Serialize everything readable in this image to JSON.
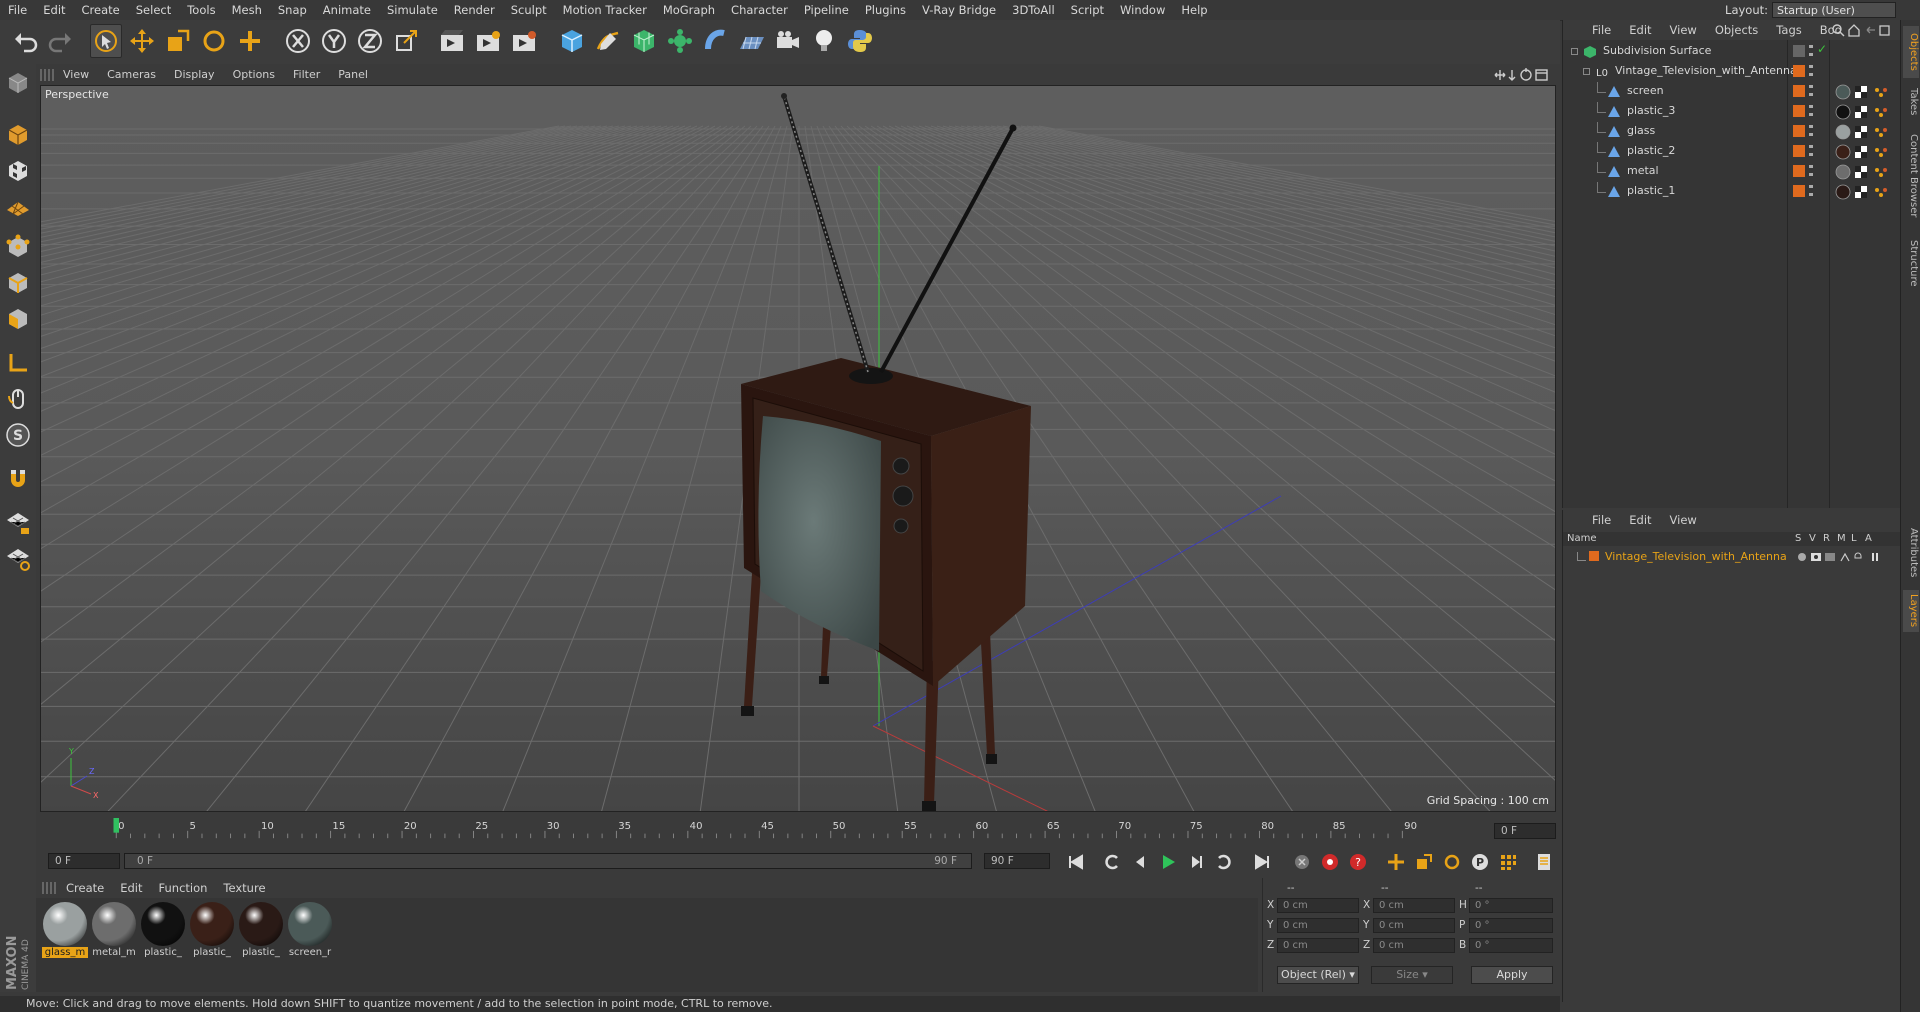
{
  "menubar": {
    "items": [
      "File",
      "Edit",
      "Create",
      "Select",
      "Tools",
      "Mesh",
      "Snap",
      "Animate",
      "Simulate",
      "Render",
      "Sculpt",
      "Motion Tracker",
      "MoGraph",
      "Character",
      "Pipeline",
      "Plugins",
      "V-Ray Bridge",
      "3DToAll",
      "Script",
      "Window",
      "Help"
    ],
    "layout_label": "Layout:",
    "layout_value": "Startup (User)"
  },
  "viewport": {
    "menu": [
      "View",
      "Cameras",
      "Display",
      "Options",
      "Filter",
      "Panel"
    ],
    "camera_label": "Perspective",
    "grid_spacing": "Grid Spacing : 100 cm"
  },
  "timeline": {
    "ticks": [
      "0",
      "5",
      "10",
      "15",
      "20",
      "25",
      "30",
      "35",
      "40",
      "45",
      "50",
      "55",
      "60",
      "65",
      "70",
      "75",
      "80",
      "85",
      "90"
    ],
    "current_frame": "0 F",
    "start_field": "0 F",
    "range_start": "0 F",
    "range_end": "90 F",
    "end_field": "90 F",
    "right_field": "0 F"
  },
  "materials": {
    "menu": [
      "Create",
      "Edit",
      "Function",
      "Texture"
    ],
    "items": [
      {
        "label": "glass_m",
        "color": "#9aa0a0"
      },
      {
        "label": "metal_m",
        "color": "#6d6d6d"
      },
      {
        "label": "plastic_",
        "color": "#111111"
      },
      {
        "label": "plastic_",
        "color": "#3a2018"
      },
      {
        "label": "plastic_",
        "color": "#2a1a16"
      },
      {
        "label": "screen_r",
        "color": "#4b5a58"
      }
    ]
  },
  "coords": {
    "headers": [
      "--",
      "--",
      "--"
    ],
    "rows": [
      {
        "a": "X",
        "av": "0 cm",
        "b": "X",
        "bv": "0 cm",
        "c": "H",
        "cv": "0 °"
      },
      {
        "a": "Y",
        "av": "0 cm",
        "b": "Y",
        "bv": "0 cm",
        "c": "P",
        "cv": "0 °"
      },
      {
        "a": "Z",
        "av": "0 cm",
        "b": "Z",
        "bv": "0 cm",
        "c": "B",
        "cv": "0 °"
      }
    ],
    "mode": "Object (Rel)",
    "size": "Size",
    "apply": "Apply"
  },
  "status": "Move: Click and drag to move elements. Hold down SHIFT to quantize movement / add to the selection in point mode, CTRL to remove.",
  "objects": {
    "menu": [
      "File",
      "Edit",
      "View",
      "Objects",
      "Tags",
      "Boo"
    ],
    "items": [
      {
        "name": "Subdivision Surface",
        "indent": 0
      },
      {
        "name": "Vintage_Television_with_Antenna",
        "indent": 1
      },
      {
        "name": "screen",
        "indent": 2
      },
      {
        "name": "plastic_3",
        "indent": 2
      },
      {
        "name": "glass",
        "indent": 2
      },
      {
        "name": "plastic_2",
        "indent": 2
      },
      {
        "name": "metal",
        "indent": 2
      },
      {
        "name": "plastic_1",
        "indent": 2
      }
    ]
  },
  "layers": {
    "menu": [
      "File",
      "Edit",
      "View"
    ],
    "columns": [
      "Name",
      "S",
      "V",
      "R",
      "M",
      "L",
      "A"
    ],
    "items": [
      {
        "name": "Vintage_Television_with_Antenna"
      }
    ]
  },
  "side_tabs": [
    "Objects",
    "Takes",
    "Content Browser",
    "Structure",
    "Attributes",
    "Layers"
  ],
  "brand": "MAXON CINEMA 4D",
  "colors": {
    "accent": "#e8a317",
    "bg": "#3a3a3a"
  }
}
